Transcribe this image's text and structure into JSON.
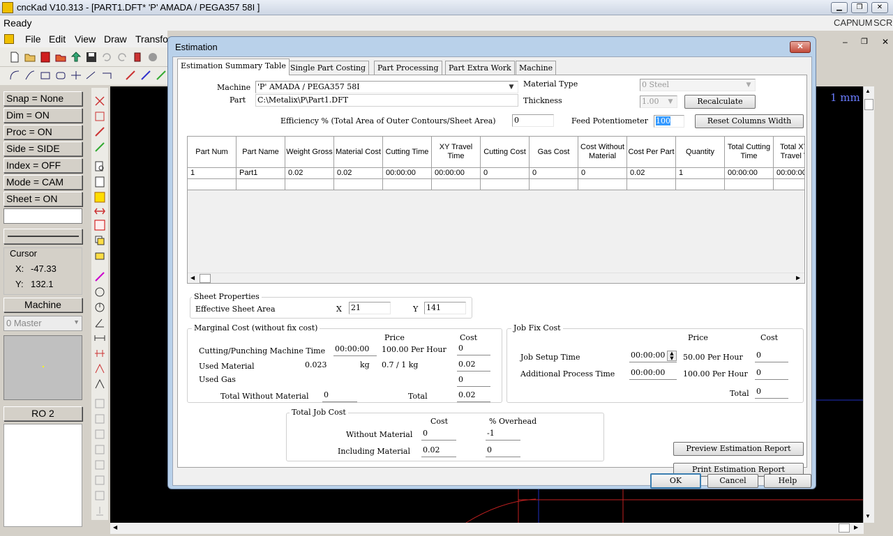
{
  "app": {
    "title": "cncKad V10.313 - [PART1.DFT*  'P'  AMADA / PEGA357   58I   ]",
    "status": "Ready",
    "indicators": [
      "CAP",
      "NUM",
      "SCRL"
    ],
    "menu": [
      "File",
      "Edit",
      "View",
      "Draw",
      "Transfo"
    ],
    "canvas_unit": "1 mm"
  },
  "left_panel": {
    "buttons": [
      "Snap = None",
      "Dim   = ON",
      "Proc  = ON",
      "Side  = SIDE",
      "Index = OFF",
      "Mode = CAM",
      "Sheet = ON"
    ],
    "cursor_label": "Cursor",
    "cursor_x_label": "X:",
    "cursor_x": "-47.33",
    "cursor_y_label": "Y:",
    "cursor_y": "132.1",
    "machine_button": "Machine",
    "master_select": "0 Master",
    "ro_button": "RO 2"
  },
  "dialog": {
    "title": "Estimation",
    "close_glyph": "✕",
    "tabs": [
      "Estimation Summary Table",
      "Single Part Costing",
      "Part Processing",
      "Part Extra Work",
      "Machine"
    ],
    "machine_label": "Machine",
    "machine_value": "'P'  AMADA / PEGA357   58I",
    "part_label": "Part",
    "part_value": "C:\\Metalix\\P\\Part1.DFT",
    "material_type_label": "Material Type",
    "material_type_value": "0   Steel",
    "thickness_label": "Thickness",
    "thickness_value": "1.00",
    "recalculate": "Recalculate",
    "efficiency_label": "Efficiency % (Total Area of Outer Contours/Sheet Area)",
    "efficiency_value": "0",
    "feed_label": "Feed Potentiometer",
    "feed_value": "100",
    "reset_columns": "Reset Columns Width",
    "grid": {
      "columns": [
        "Part Num",
        "Part Name",
        "Weight Gross",
        "Material Cost",
        "Cutting Time",
        "XY Travel Time",
        "Cutting Cost",
        "Gas Cost",
        "Cost Without Material",
        "Cost Per Part",
        "Quantity",
        "Total Cutting Time",
        "Total XY Travel T"
      ],
      "rows": [
        [
          "1",
          "Part1",
          "0.02",
          "0.02",
          "00:00:00",
          "00:00:00",
          "0",
          "0",
          "0",
          "0.02",
          "1",
          "00:00:00",
          "00:00:00"
        ]
      ]
    },
    "sheet": {
      "title": "Sheet Properties",
      "area_label": "Effective Sheet Area",
      "x_label": "X",
      "x_value": "21",
      "y_label": "Y",
      "y_value": "141"
    },
    "marginal": {
      "title": "Marginal Cost (without fix cost)",
      "price_header": "Price",
      "cost_header": "Cost",
      "cutting_label": "Cutting/Punching Machine Time",
      "cutting_time": "00:00:00",
      "cutting_price": "100.00 Per Hour",
      "cutting_cost": "0",
      "material_label": "Used Material",
      "material_qty": "0.023",
      "material_unit": "kg",
      "material_price": "0.7 / 1 kg",
      "material_cost": "0.02",
      "gas_label": "Used Gas",
      "gas_cost": "0",
      "total_without_label": "Total Without Material",
      "total_without_value": "0",
      "total_label": "Total",
      "total_value": "0.02"
    },
    "jobfix": {
      "title": "Job Fix Cost",
      "price_header": "Price",
      "cost_header": "Cost",
      "setup_label": "Job Setup Time",
      "setup_time": "00:00:00",
      "setup_price": "50.00 Per Hour",
      "setup_cost": "0",
      "additional_label": "Additional Process Time",
      "additional_time": "00:00:00",
      "additional_price": "100.00 Per Hour",
      "additional_cost": "0",
      "total_label": "Total",
      "total_value": "0"
    },
    "totaljob": {
      "title": "Total Job Cost",
      "cost_header": "Cost",
      "overhead_header": "% Overhead",
      "without_label": "Without Material",
      "without_cost": "0",
      "without_overhead": "-1",
      "including_label": "Including Material",
      "including_cost": "0.02",
      "including_overhead": "0"
    },
    "preview_report": "Preview Estimation Report",
    "print_report": "Print Estimation Report",
    "ok": "OK",
    "cancel": "Cancel",
    "help": "Help"
  }
}
